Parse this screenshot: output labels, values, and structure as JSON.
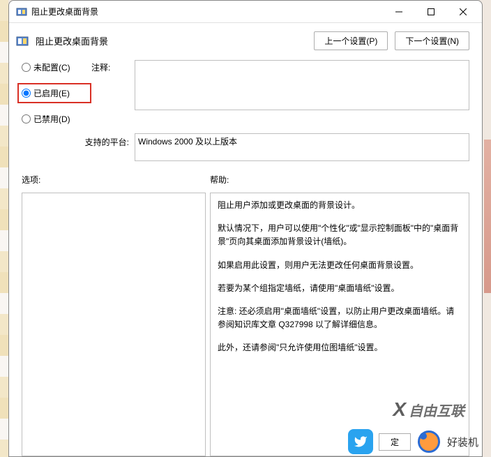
{
  "titlebar": {
    "title": "阻止更改桌面背景"
  },
  "header": {
    "title": "阻止更改桌面背景",
    "prev_btn": "上一个设置(P)",
    "next_btn": "下一个设置(N)"
  },
  "radios": {
    "not_configured": "未配置(C)",
    "enabled": "已启用(E)",
    "disabled": "已禁用(D)"
  },
  "labels": {
    "comment": "注释:",
    "platform": "支持的平台:",
    "options": "选项:",
    "help": "帮助:"
  },
  "platform_text": "Windows 2000 及以上版本",
  "help_paragraphs": [
    "阻止用户添加或更改桌面的背景设计。",
    "默认情况下，用户可以使用\"个性化\"或\"显示控制面板\"中的\"桌面背景\"页向其桌面添加背景设计(墙纸)。",
    "如果启用此设置，则用户无法更改任何桌面背景设置。",
    "若要为某个组指定墙纸，请使用\"桌面墙纸\"设置。",
    "注意: 还必须启用\"桌面墙纸\"设置，以防止用户更改桌面墙纸。请参阅知识库文章 Q327998 以了解详细信息。",
    "此外，还请参阅\"只允许使用位图墙纸\"设置。"
  ],
  "buttons": {
    "ok": "定"
  },
  "watermarks": {
    "w1": "自由互联",
    "w2": "好装机"
  }
}
